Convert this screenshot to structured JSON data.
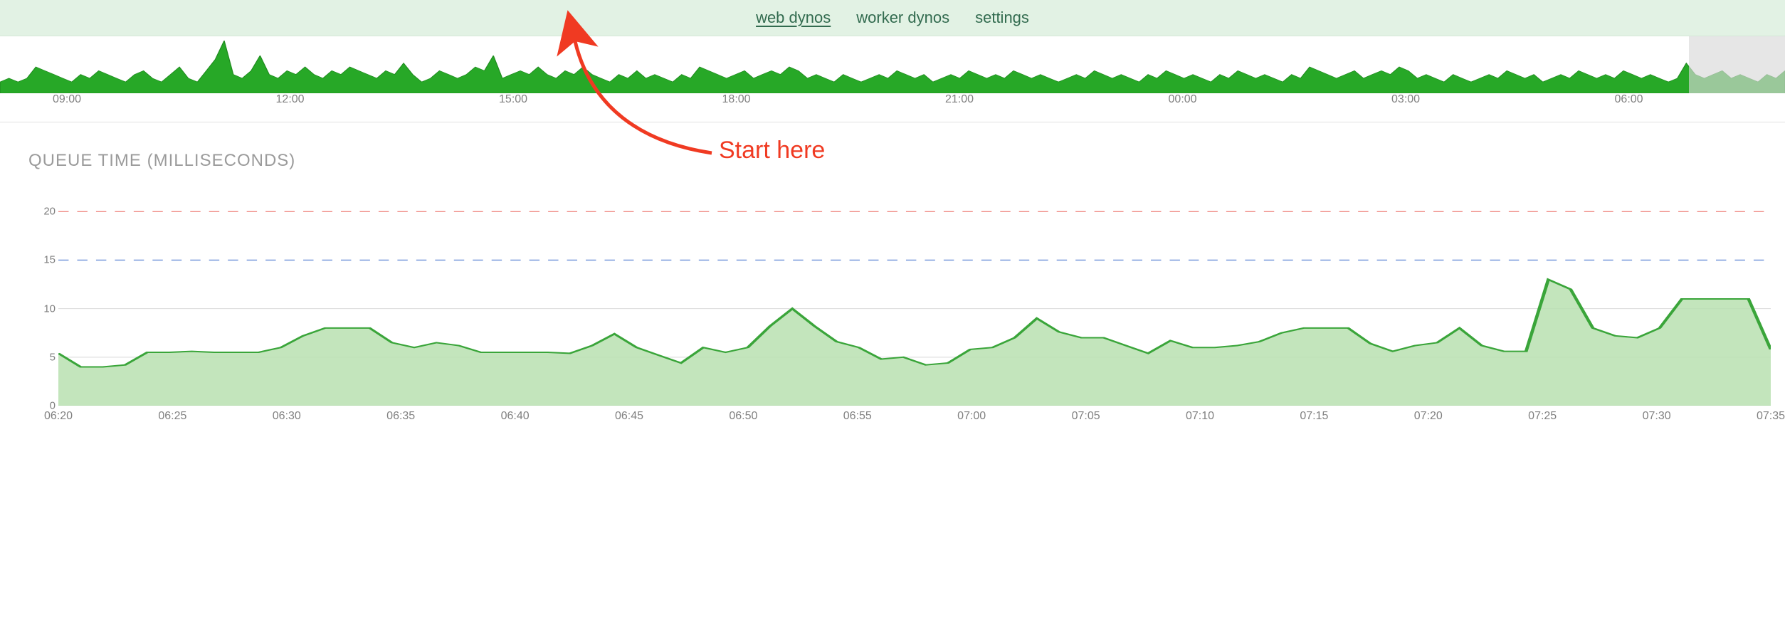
{
  "nav": {
    "items": [
      {
        "label": "web dynos",
        "active": true
      },
      {
        "label": "worker dynos",
        "active": false
      },
      {
        "label": "settings",
        "active": false
      }
    ]
  },
  "overview": {
    "x_labels": [
      "09:00",
      "12:00",
      "15:00",
      "18:00",
      "21:00",
      "00:00",
      "03:00",
      "06:00"
    ],
    "brush_start_pct": 94.6,
    "brush_end_pct": 100,
    "spark_values": [
      3,
      4,
      3,
      4,
      7,
      6,
      5,
      4,
      3,
      5,
      4,
      6,
      5,
      4,
      3,
      5,
      6,
      4,
      3,
      5,
      7,
      4,
      3,
      6,
      9,
      14,
      5,
      4,
      6,
      10,
      5,
      4,
      6,
      5,
      7,
      5,
      4,
      6,
      5,
      7,
      6,
      5,
      4,
      6,
      5,
      8,
      5,
      3,
      4,
      6,
      5,
      4,
      5,
      7,
      6,
      10,
      4,
      5,
      6,
      5,
      7,
      5,
      4,
      6,
      5,
      7,
      5,
      4,
      3,
      5,
      4,
      6,
      4,
      5,
      4,
      3,
      5,
      4,
      7,
      6,
      5,
      4,
      5,
      6,
      4,
      5,
      6,
      5,
      7,
      6,
      4,
      5,
      4,
      3,
      5,
      4,
      3,
      4,
      5,
      4,
      6,
      5,
      4,
      5,
      3,
      4,
      5,
      4,
      6,
      5,
      4,
      5,
      4,
      6,
      5,
      4,
      5,
      4,
      3,
      4,
      5,
      4,
      6,
      5,
      4,
      5,
      4,
      3,
      5,
      4,
      6,
      5,
      4,
      5,
      4,
      3,
      5,
      4,
      6,
      5,
      4,
      5,
      4,
      3,
      5,
      4,
      7,
      6,
      5,
      4,
      5,
      6,
      4,
      5,
      6,
      5,
      7,
      6,
      4,
      5,
      4,
      3,
      5,
      4,
      3,
      4,
      5,
      4,
      6,
      5,
      4,
      5,
      3,
      4,
      5,
      4,
      6,
      5,
      4,
      5,
      4,
      6,
      5,
      4,
      5,
      4,
      3,
      4,
      8,
      5,
      4,
      5,
      6,
      4,
      5,
      4,
      3,
      5,
      4,
      6
    ]
  },
  "queue_chart": {
    "title": "QUEUE TIME (MILLISECONDS)",
    "y_ticks": [
      0.0,
      5.0,
      10,
      15,
      20
    ],
    "x_labels": [
      "06:20",
      "06:25",
      "06:30",
      "06:35",
      "06:40",
      "06:45",
      "06:50",
      "06:55",
      "07:00",
      "07:05",
      "07:10",
      "07:15",
      "07:20",
      "07:25",
      "07:30",
      "07:35"
    ],
    "thresholds": [
      {
        "value": 20,
        "color": "#f08c86"
      },
      {
        "value": 15,
        "color": "#6a8fd8"
      }
    ]
  },
  "annotation": {
    "text": "Start here"
  },
  "chart_data": {
    "type": "area",
    "title": "QUEUE TIME (MILLISECONDS)",
    "xlabel": "",
    "ylabel": "",
    "ylim": [
      0,
      22
    ],
    "x": [
      "06:18",
      "06:19",
      "06:20",
      "06:21",
      "06:22",
      "06:23",
      "06:24",
      "06:25",
      "06:26",
      "06:27",
      "06:28",
      "06:29",
      "06:30",
      "06:31",
      "06:32",
      "06:33",
      "06:34",
      "06:35",
      "06:36",
      "06:37",
      "06:38",
      "06:39",
      "06:40",
      "06:41",
      "06:42",
      "06:43",
      "06:44",
      "06:45",
      "06:46",
      "06:47",
      "06:48",
      "06:49",
      "06:50",
      "06:51",
      "06:52",
      "06:53",
      "06:54",
      "06:55",
      "06:56",
      "06:57",
      "06:58",
      "06:59",
      "07:00",
      "07:01",
      "07:02",
      "07:03",
      "07:04",
      "07:05",
      "07:06",
      "07:07",
      "07:08",
      "07:09",
      "07:10",
      "07:11",
      "07:12",
      "07:13",
      "07:14",
      "07:15",
      "07:16",
      "07:17",
      "07:18",
      "07:19",
      "07:20",
      "07:21",
      "07:22",
      "07:23",
      "07:24",
      "07:25",
      "07:26",
      "07:27",
      "07:28",
      "07:29",
      "07:30",
      "07:31",
      "07:32",
      "07:33",
      "07:34",
      "07:35"
    ],
    "values": [
      5.4,
      4.0,
      4.0,
      4.2,
      5.5,
      5.5,
      5.6,
      5.5,
      5.5,
      5.5,
      6.0,
      7.2,
      8.0,
      8.0,
      8.0,
      6.5,
      6.0,
      6.5,
      6.2,
      5.5,
      5.5,
      5.5,
      5.5,
      5.4,
      6.2,
      7.4,
      6.0,
      5.2,
      4.4,
      6.0,
      5.5,
      6.0,
      8.2,
      10.0,
      8.2,
      6.6,
      6.0,
      4.8,
      5.0,
      4.2,
      4.4,
      5.8,
      6.0,
      7.0,
      9.0,
      7.6,
      7.0,
      7.0,
      6.2,
      5.4,
      6.7,
      6.0,
      6.0,
      6.2,
      6.6,
      7.5,
      8.0,
      8.0,
      8.0,
      6.4,
      5.6,
      6.2,
      6.5,
      8.0,
      6.2,
      5.6,
      5.6,
      13.0,
      12.0,
      8.0,
      7.2,
      7.0,
      8.0,
      11.0,
      11.0,
      11.0,
      11.0,
      5.8
    ],
    "thresholds": [
      {
        "value": 20,
        "color": "#f08c86"
      },
      {
        "value": 15,
        "color": "#6a8fd8"
      }
    ]
  }
}
